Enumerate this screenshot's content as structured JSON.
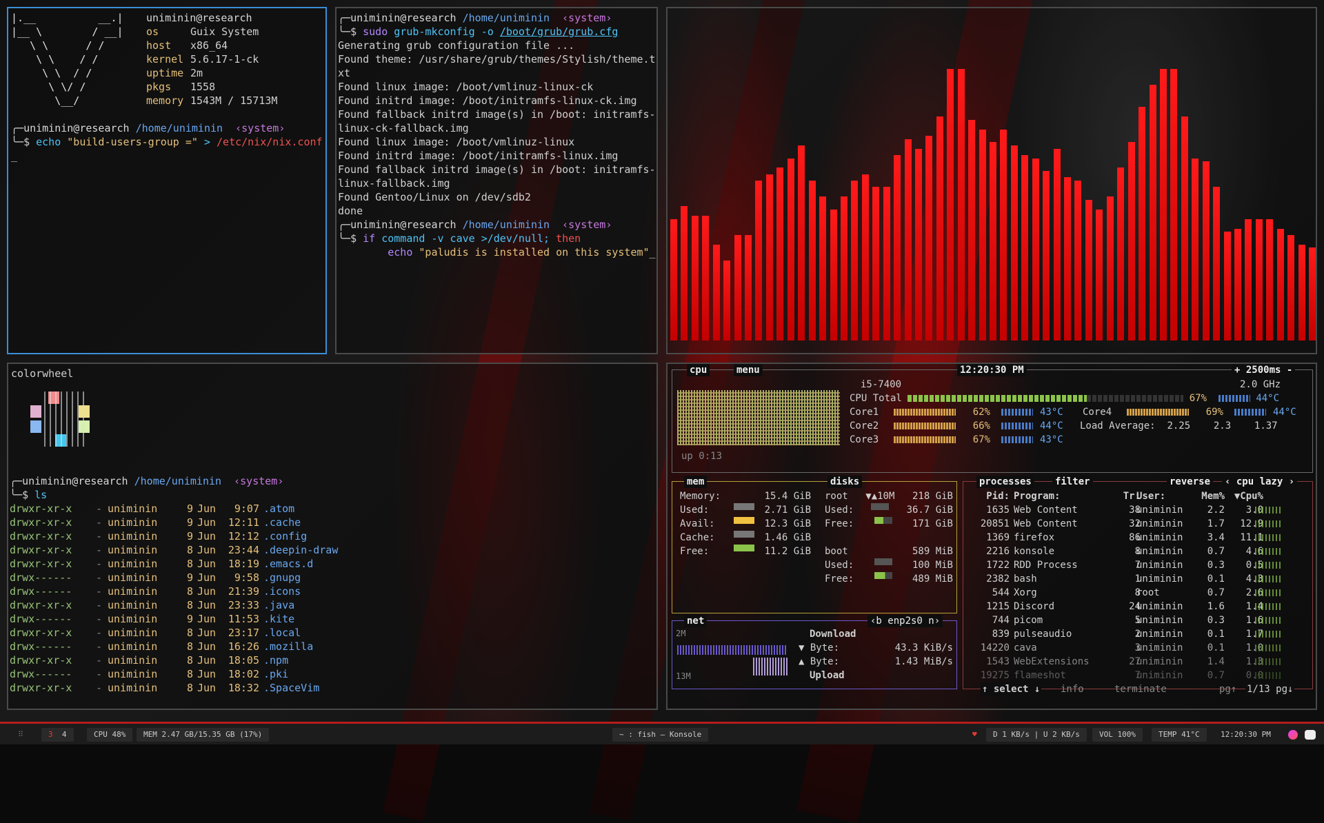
{
  "colors": {
    "accent": "#3b8fd8",
    "bar": "#e00000",
    "statusline": "#b71c1c"
  },
  "neofetch": {
    "art": [
      "|.__          __.|",
      "|__ \\        / __|",
      "   \\ \\      / /",
      "    \\ \\    / /",
      "     \\ \\  / /",
      "      \\ \\/ /",
      "       \\__/"
    ],
    "title": "uniminin@research",
    "rows": [
      {
        "k": "os",
        "v": "Guix System"
      },
      {
        "k": "host",
        "v": "x86_64"
      },
      {
        "k": "kernel",
        "v": "5.6.17-1-ck"
      },
      {
        "k": "uptime",
        "v": "2m"
      },
      {
        "k": "pkgs",
        "v": "1558"
      },
      {
        "k": "memory",
        "v": "1543M / 15713M"
      }
    ]
  },
  "prompt": {
    "user": "uniminin@research",
    "path": "/home/uniminin",
    "sys": "‹system›",
    "sym": "$"
  },
  "term1": {
    "cmd": "echo",
    "arg": "\"build-users-group =\"",
    "op": ">",
    "file": "/etc/nix/nix.conf",
    "cursor": "_"
  },
  "term2": {
    "sudo": "sudo",
    "cmd": "grub-mkconfig",
    "flag": "-o",
    "file": "/boot/grub/grub.cfg",
    "output": [
      "Generating grub configuration file ...",
      "Found theme: /usr/share/grub/themes/Stylish/theme.t",
      "xt",
      "Found linux image: /boot/vmlinuz-linux-ck",
      "Found initrd image: /boot/initramfs-linux-ck.img",
      "Found fallback initrd image(s) in /boot: initramfs-",
      "linux-ck-fallback.img",
      "Found linux image: /boot/vmlinuz-linux",
      "Found initrd image: /boot/initramfs-linux.img",
      "Found fallback initrd image(s) in /boot: initramfs-",
      "linux-fallback.img",
      "Found Gentoo/Linux on /dev/sdb2",
      "done"
    ],
    "l1_if": "if",
    "l1_cmd": "command",
    "l1_flag": "-v cave",
    "l1_redir": ">/dev/null;",
    "l1_then": "then",
    "l2_echo": "echo",
    "l2_str": "\"paludis is installed on this system\"",
    "cursor": "_"
  },
  "cava": {
    "values": [
      0.38,
      0.42,
      0.39,
      0.39,
      0.3,
      0.25,
      0.33,
      0.33,
      0.5,
      0.52,
      0.54,
      0.57,
      0.61,
      0.5,
      0.45,
      0.41,
      0.45,
      0.5,
      0.52,
      0.48,
      0.48,
      0.58,
      0.63,
      0.6,
      0.64,
      0.7,
      0.85,
      0.85,
      0.69,
      0.66,
      0.62,
      0.66,
      0.61,
      0.58,
      0.57,
      0.53,
      0.6,
      0.51,
      0.5,
      0.44,
      0.41,
      0.45,
      0.54,
      0.62,
      0.73,
      0.8,
      0.85,
      0.85,
      0.7,
      0.57,
      0.56,
      0.48,
      0.34,
      0.35,
      0.38,
      0.38,
      0.38,
      0.35,
      0.33,
      0.3,
      0.29
    ]
  },
  "colorwheel": {
    "title": "colorwheel"
  },
  "term3": {
    "cmd": "ls",
    "rows": [
      {
        "p": "drwxr-xr-x",
        "u": "uniminin",
        "d": "9",
        "m": "Jun",
        "t": "9:07",
        "n": ".atom"
      },
      {
        "p": "drwxr-xr-x",
        "u": "uniminin",
        "d": "9",
        "m": "Jun",
        "t": "12:11",
        "n": ".cache"
      },
      {
        "p": "drwxr-xr-x",
        "u": "uniminin",
        "d": "9",
        "m": "Jun",
        "t": "12:12",
        "n": ".config"
      },
      {
        "p": "drwxr-xr-x",
        "u": "uniminin",
        "d": "8",
        "m": "Jun",
        "t": "23:44",
        "n": ".deepin-draw"
      },
      {
        "p": "drwxr-xr-x",
        "u": "uniminin",
        "d": "8",
        "m": "Jun",
        "t": "18:19",
        "n": ".emacs.d"
      },
      {
        "p": "drwx------",
        "u": "uniminin",
        "d": "9",
        "m": "Jun",
        "t": "9:58",
        "n": ".gnupg"
      },
      {
        "p": "drwx------",
        "u": "uniminin",
        "d": "8",
        "m": "Jun",
        "t": "21:39",
        "n": ".icons"
      },
      {
        "p": "drwxr-xr-x",
        "u": "uniminin",
        "d": "8",
        "m": "Jun",
        "t": "23:33",
        "n": ".java"
      },
      {
        "p": "drwx------",
        "u": "uniminin",
        "d": "9",
        "m": "Jun",
        "t": "11:53",
        "n": ".kite"
      },
      {
        "p": "drwxr-xr-x",
        "u": "uniminin",
        "d": "8",
        "m": "Jun",
        "t": "23:17",
        "n": ".local"
      },
      {
        "p": "drwx------",
        "u": "uniminin",
        "d": "8",
        "m": "Jun",
        "t": "16:26",
        "n": ".mozilla"
      },
      {
        "p": "drwxr-xr-x",
        "u": "uniminin",
        "d": "8",
        "m": "Jun",
        "t": "18:05",
        "n": ".npm"
      },
      {
        "p": "drwx------",
        "u": "uniminin",
        "d": "8",
        "m": "Jun",
        "t": "18:02",
        "n": ".pki"
      },
      {
        "p": "drwxr-xr-x",
        "u": "uniminin",
        "d": "8",
        "m": "Jun",
        "t": "18:32",
        "n": ".SpaceVim"
      }
    ]
  },
  "btop": {
    "cpu_tab": "cpu",
    "menu_tab": "menu",
    "clock": "12:20:30 PM",
    "interval": "+ 2500ms -",
    "cpu_name": "i5-7400",
    "freq": "2.0 GHz",
    "uptime": "up 0:13",
    "cpu_total_label": "CPU Total",
    "cpu_total": "67%",
    "cpu_total_temp": "44°C",
    "cores": [
      {
        "n": "Core1",
        "p": "62%",
        "t": "43°C"
      },
      {
        "n": "Core2",
        "p": "66%",
        "t": "44°C"
      },
      {
        "n": "Core3",
        "p": "67%",
        "t": "43°C"
      },
      {
        "n": "Core4",
        "p": "69%",
        "t": "44°C"
      }
    ],
    "load_label": "Load Average:",
    "load": [
      "2.25",
      "2.3",
      "1.37"
    ],
    "mem": {
      "tab": "mem",
      "rows": [
        {
          "k": "Memory:",
          "v": "15.4 GiB"
        },
        {
          "k": "Used:",
          "v": "2.71 GiB"
        },
        {
          "k": "Avail:",
          "v": "12.3 GiB"
        },
        {
          "k": "Cache:",
          "v": "1.46 GiB"
        },
        {
          "k": "Free:",
          "v": "11.2 GiB"
        }
      ]
    },
    "disks": {
      "tab": "disks",
      "root": "root",
      "root_io": "▼▲10M",
      "root_size": "218 GiB",
      "root_used": "36.7 GiB",
      "root_free": "171 GiB",
      "boot": "boot",
      "boot_size": "589 MiB",
      "boot_used": "100 MiB",
      "boot_free": "489 MiB",
      "used_label": "Used:",
      "free_label": "Free:"
    },
    "net": {
      "tab": "net",
      "iface": "‹b enp2s0 n›",
      "top": "2M",
      "bottom": "13M",
      "download": "Download",
      "down_label": "▼ Byte:",
      "down_val": "43.3 KiB/s",
      "up_label": "▲ Byte:",
      "up_val": "1.43 MiB/s",
      "upload": "Upload"
    },
    "proc": {
      "tab": "processes",
      "filter": "filter",
      "reverse": "reverse",
      "mode": "‹ cpu lazy ›",
      "headers": [
        "Pid:",
        "Program:",
        "Tr:",
        "User:",
        "Mem%",
        "▼Cpu%"
      ],
      "rows": [
        {
          "pid": "1635",
          "prog": "Web Content",
          "tr": "38",
          "user": "uniminin",
          "mem": "2.2",
          "cpu": "3.0"
        },
        {
          "pid": "20851",
          "prog": "Web Content",
          "tr": "32",
          "user": "uniminin",
          "mem": "1.7",
          "cpu": "12.9"
        },
        {
          "pid": "1369",
          "prog": "firefox",
          "tr": "86",
          "user": "uniminin",
          "mem": "3.4",
          "cpu": "11.1"
        },
        {
          "pid": "2216",
          "prog": "konsole",
          "tr": "8",
          "user": "uniminin",
          "mem": "0.7",
          "cpu": "4.6"
        },
        {
          "pid": "1722",
          "prog": "RDD Process",
          "tr": "7",
          "user": "uniminin",
          "mem": "0.3",
          "cpu": "0.5"
        },
        {
          "pid": "2382",
          "prog": "bash",
          "tr": "1",
          "user": "uniminin",
          "mem": "0.1",
          "cpu": "4.3"
        },
        {
          "pid": "544",
          "prog": "Xorg",
          "tr": "8",
          "user": "root",
          "mem": "0.7",
          "cpu": "2.6"
        },
        {
          "pid": "1215",
          "prog": "Discord",
          "tr": "24",
          "user": "uniminin",
          "mem": "1.6",
          "cpu": "1.4"
        },
        {
          "pid": "744",
          "prog": "picom",
          "tr": "5",
          "user": "uniminin",
          "mem": "0.3",
          "cpu": "1.6"
        },
        {
          "pid": "839",
          "prog": "pulseaudio",
          "tr": "2",
          "user": "uniminin",
          "mem": "0.1",
          "cpu": "1.7"
        },
        {
          "pid": "14220",
          "prog": "cava",
          "tr": "3",
          "user": "uniminin",
          "mem": "0.1",
          "cpu": "1.0"
        },
        {
          "pid": "1543",
          "prog": "WebExtensions",
          "tr": "27",
          "user": "uniminin",
          "mem": "1.4",
          "cpu": "1.3"
        },
        {
          "pid": "19275",
          "prog": "flameshot",
          "tr": "7",
          "user": "uniminin",
          "mem": "0.7",
          "cpu": "0.0"
        }
      ],
      "footer_select": "↑ select ↓",
      "footer_info": "info",
      "footer_term": "terminate",
      "footer_pg": "pg↑",
      "footer_page": "1/13 pg↓"
    }
  },
  "statusbar": {
    "ws_grid": "⠿",
    "ws_active": "3",
    "ws_next": "4",
    "cpu": "CPU 48%",
    "mem": "MEM 2.47 GB/15.35 GB (17%)",
    "title": "~ : fish — Konsole",
    "heart": "♥",
    "net": "D 1 KB/s | U 2 KB/s",
    "vol": "VOL 100%",
    "temp": "TEMP 41°C",
    "time": "12:20:30 PM"
  }
}
